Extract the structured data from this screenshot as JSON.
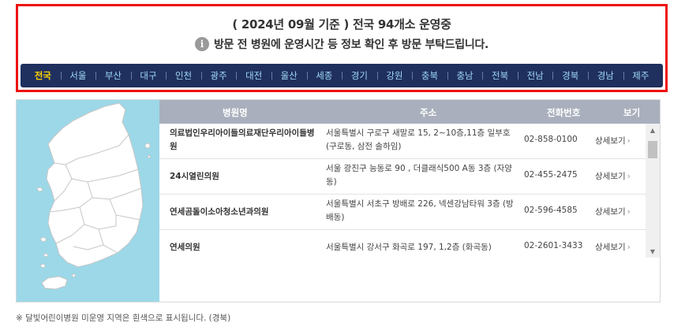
{
  "notice": {
    "headline": "( 2024년 09월 기준 ) 전국 94개소 운영중",
    "info_icon": "i",
    "subline": "방문 전 병원에 운영시간 등 정보 확인 후 방문 부탁드립니다."
  },
  "regions": [
    "전국",
    "서울",
    "부산",
    "대구",
    "인천",
    "광주",
    "대전",
    "울산",
    "세종",
    "경기",
    "강원",
    "충북",
    "충남",
    "전북",
    "전남",
    "경북",
    "경남",
    "제주"
  ],
  "active_region": "전국",
  "table": {
    "headers": {
      "name": "병원명",
      "address": "주소",
      "phone": "전화번호",
      "view": "보기"
    },
    "rows": [
      {
        "name": "의료법인우리아이들의료재단우리아이들병원",
        "address": "서울특별시 구로구 새말로 15, 2~10층,11층 일부호 (구로동, 삼전 솔하임)",
        "phone": "02-858-0100",
        "view": "상세보기"
      },
      {
        "name": "24시열린의원",
        "address": "서울 광진구 능동로 90 , 더클래식500 A동 3층 (자양동)",
        "phone": "02-455-2475",
        "view": "상세보기"
      },
      {
        "name": "연세곰돌이소아청소년과의원",
        "address": "서울특별시 서초구 방배로 226, 넥센강남타워 3층 (방배동)",
        "phone": "02-596-4585",
        "view": "상세보기"
      },
      {
        "name": "연세의원",
        "address": "서울특별시 강서구 화곡로 197, 1,2층 (화곡동)",
        "phone": "02-2601-3433",
        "view": "상세보기"
      }
    ]
  },
  "footnote": "※ 달빛어린이병원 미운영 지역은 흰색으로 표시됩니다. (경북)",
  "colors": {
    "accent_border": "#ee1111",
    "nav_bg": "#1f2f5e",
    "nav_text": "#9fd9f5",
    "nav_active": "#ffd400",
    "map_bg": "#9cd8e8",
    "table_head": "#a9afbc"
  }
}
